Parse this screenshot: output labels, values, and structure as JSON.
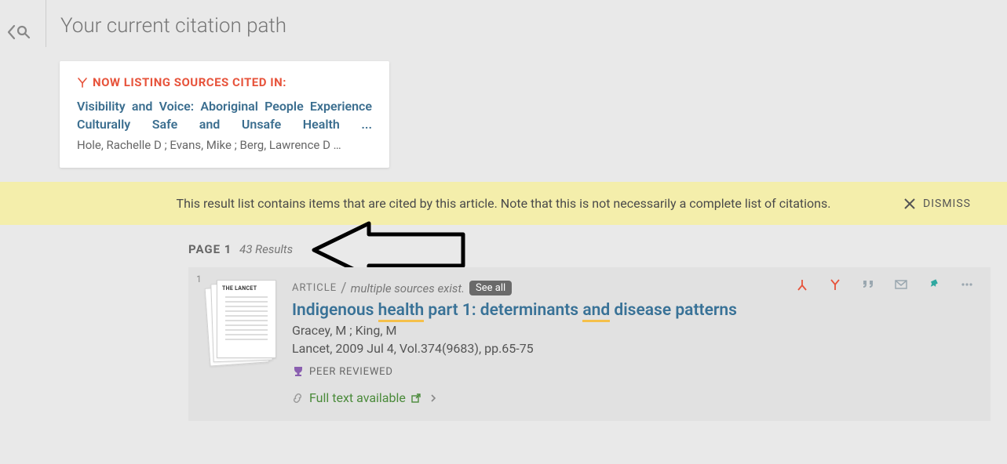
{
  "header": {
    "title": "Your current citation path"
  },
  "citation_card": {
    "label": "NOW LISTING SOURCES CITED IN:",
    "title": "Visibility and Voice: Aboriginal People Experience Culturally Safe and Unsafe Health ...",
    "authors": "Hole, Rachelle D ; Evans, Mike ; Berg, Lawrence D …"
  },
  "notice": {
    "text": "This result list contains items that are cited by this article. Note that this is not necessarily a complete list of citations.",
    "dismiss": "DISMISS"
  },
  "results": {
    "page_label": "PAGE 1",
    "count_label": "43 Results"
  },
  "result_1": {
    "number": "1",
    "type": "ARTICLE",
    "sources_text": "multiple sources exist.",
    "see_all": "See all",
    "title_pre": "Indigenous ",
    "title_u1": "health",
    "title_mid": " part 1: determinants ",
    "title_u2": "and",
    "title_post": " disease patterns",
    "authors": "Gracey, M ; King, M",
    "citation": "Lancet, 2009 Jul 4, Vol.374(9683), pp.65-75",
    "peer": "PEER REVIEWED",
    "full_text": "Full text available"
  }
}
